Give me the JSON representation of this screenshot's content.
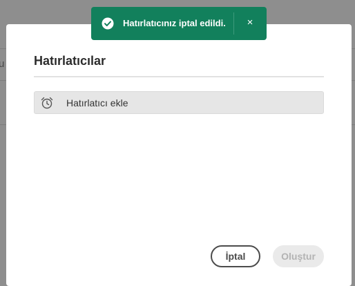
{
  "background": {
    "fragment": "u"
  },
  "dialog": {
    "title": "Hatırlatıcılar",
    "add_reminder_label": "Hatırlatıcı ekle",
    "cancel_label": "İptal",
    "create_label": "Oluştur"
  },
  "toast": {
    "message": "Hatırlatıcınız iptal edildi.",
    "close_glyph": "×",
    "color": "#12805c"
  },
  "icons": {
    "alarm": "alarm-clock-icon",
    "toast_status": "checkmark-circle-icon",
    "toast_close": "close-icon"
  }
}
